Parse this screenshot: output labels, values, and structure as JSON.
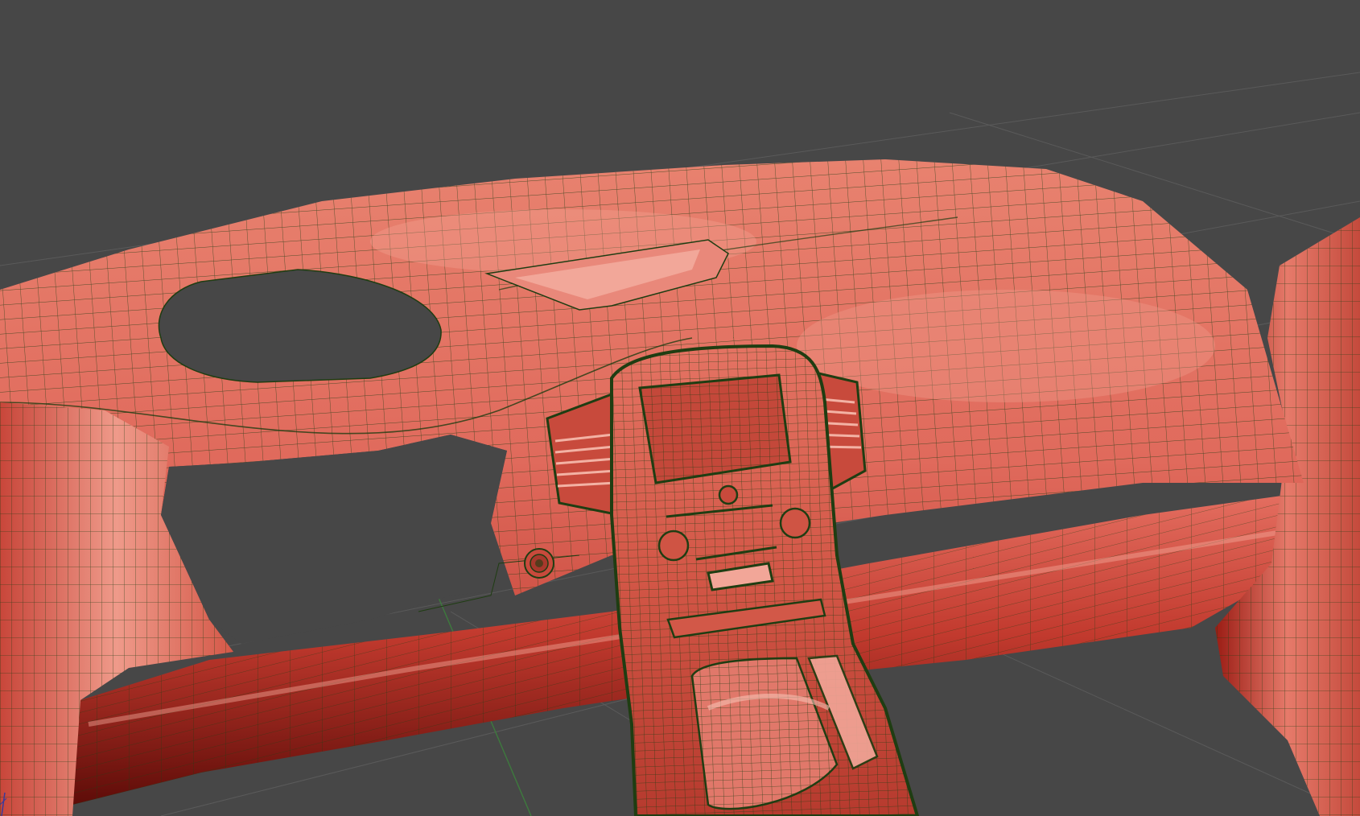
{
  "viewport": {
    "background": "#474747",
    "grid_color": "#5a5a5a",
    "axis_y_color": "#3d7a3d",
    "axis_x_color": "#3a3a9a"
  },
  "model": {
    "base_color": "#e06a5c",
    "shadow_color": "#8a1a12",
    "highlight_color": "#f6b4a8",
    "wire_color": "#1f3d12",
    "display": "wireframe-on-shaded"
  },
  "icons": {
    "axis_gizmo": "axis-gizmo-icon"
  }
}
